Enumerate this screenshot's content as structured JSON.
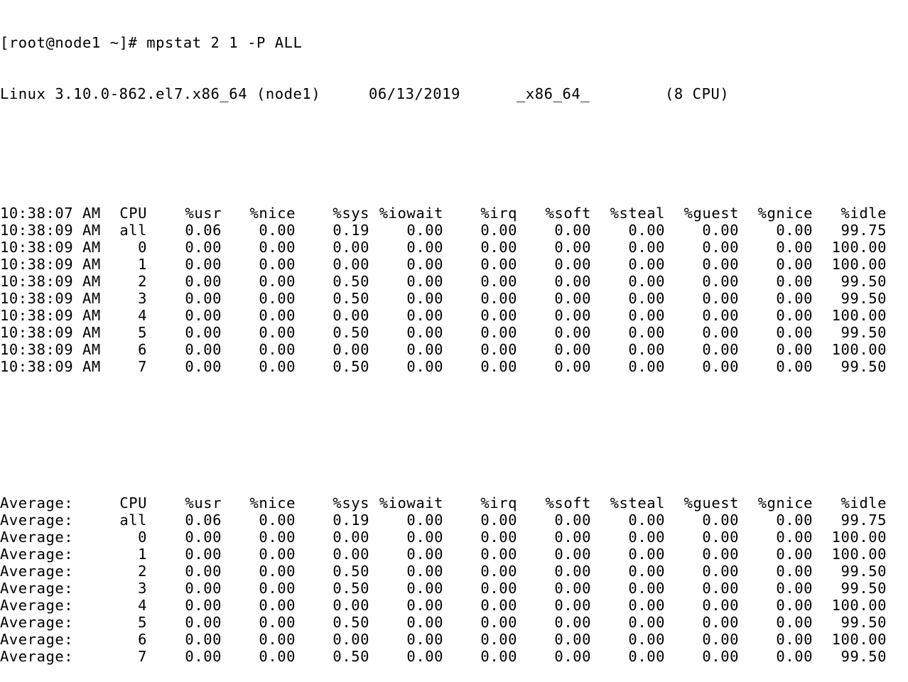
{
  "prompt": "[root@node1 ~]# mpstat 2 1 -P ALL",
  "sysinfo": {
    "kernel": "Linux 3.10.0-862.el7.x86_64 (node1)",
    "date": "06/13/2019",
    "arch": "_x86_64_",
    "cpus": "(8 CPU)"
  },
  "sample": {
    "header": [
      "10:38:07 AM",
      "CPU",
      "%usr",
      "%nice",
      "%sys",
      "%iowait",
      "%irq",
      "%soft",
      "%steal",
      "%guest",
      "%gnice",
      "%idle"
    ],
    "rows": [
      [
        "10:38:09 AM",
        "all",
        "0.06",
        "0.00",
        "0.19",
        "0.00",
        "0.00",
        "0.00",
        "0.00",
        "0.00",
        "0.00",
        "99.75"
      ],
      [
        "10:38:09 AM",
        "0",
        "0.00",
        "0.00",
        "0.00",
        "0.00",
        "0.00",
        "0.00",
        "0.00",
        "0.00",
        "0.00",
        "100.00"
      ],
      [
        "10:38:09 AM",
        "1",
        "0.00",
        "0.00",
        "0.00",
        "0.00",
        "0.00",
        "0.00",
        "0.00",
        "0.00",
        "0.00",
        "100.00"
      ],
      [
        "10:38:09 AM",
        "2",
        "0.00",
        "0.00",
        "0.50",
        "0.00",
        "0.00",
        "0.00",
        "0.00",
        "0.00",
        "0.00",
        "99.50"
      ],
      [
        "10:38:09 AM",
        "3",
        "0.00",
        "0.00",
        "0.50",
        "0.00",
        "0.00",
        "0.00",
        "0.00",
        "0.00",
        "0.00",
        "99.50"
      ],
      [
        "10:38:09 AM",
        "4",
        "0.00",
        "0.00",
        "0.00",
        "0.00",
        "0.00",
        "0.00",
        "0.00",
        "0.00",
        "0.00",
        "100.00"
      ],
      [
        "10:38:09 AM",
        "5",
        "0.00",
        "0.00",
        "0.50",
        "0.00",
        "0.00",
        "0.00",
        "0.00",
        "0.00",
        "0.00",
        "99.50"
      ],
      [
        "10:38:09 AM",
        "6",
        "0.00",
        "0.00",
        "0.00",
        "0.00",
        "0.00",
        "0.00",
        "0.00",
        "0.00",
        "0.00",
        "100.00"
      ],
      [
        "10:38:09 AM",
        "7",
        "0.00",
        "0.00",
        "0.50",
        "0.00",
        "0.00",
        "0.00",
        "0.00",
        "0.00",
        "0.00",
        "99.50"
      ]
    ]
  },
  "average": {
    "header": [
      "Average:",
      "CPU",
      "%usr",
      "%nice",
      "%sys",
      "%iowait",
      "%irq",
      "%soft",
      "%steal",
      "%guest",
      "%gnice",
      "%idle"
    ],
    "rows": [
      [
        "Average:",
        "all",
        "0.06",
        "0.00",
        "0.19",
        "0.00",
        "0.00",
        "0.00",
        "0.00",
        "0.00",
        "0.00",
        "99.75"
      ],
      [
        "Average:",
        "0",
        "0.00",
        "0.00",
        "0.00",
        "0.00",
        "0.00",
        "0.00",
        "0.00",
        "0.00",
        "0.00",
        "100.00"
      ],
      [
        "Average:",
        "1",
        "0.00",
        "0.00",
        "0.00",
        "0.00",
        "0.00",
        "0.00",
        "0.00",
        "0.00",
        "0.00",
        "100.00"
      ],
      [
        "Average:",
        "2",
        "0.00",
        "0.00",
        "0.50",
        "0.00",
        "0.00",
        "0.00",
        "0.00",
        "0.00",
        "0.00",
        "99.50"
      ],
      [
        "Average:",
        "3",
        "0.00",
        "0.00",
        "0.50",
        "0.00",
        "0.00",
        "0.00",
        "0.00",
        "0.00",
        "0.00",
        "99.50"
      ],
      [
        "Average:",
        "4",
        "0.00",
        "0.00",
        "0.00",
        "0.00",
        "0.00",
        "0.00",
        "0.00",
        "0.00",
        "0.00",
        "100.00"
      ],
      [
        "Average:",
        "5",
        "0.00",
        "0.00",
        "0.50",
        "0.00",
        "0.00",
        "0.00",
        "0.00",
        "0.00",
        "0.00",
        "99.50"
      ],
      [
        "Average:",
        "6",
        "0.00",
        "0.00",
        "0.00",
        "0.00",
        "0.00",
        "0.00",
        "0.00",
        "0.00",
        "0.00",
        "100.00"
      ],
      [
        "Average:",
        "7",
        "0.00",
        "0.00",
        "0.50",
        "0.00",
        "0.00",
        "0.00",
        "0.00",
        "0.00",
        "0.00",
        "99.50"
      ]
    ]
  }
}
